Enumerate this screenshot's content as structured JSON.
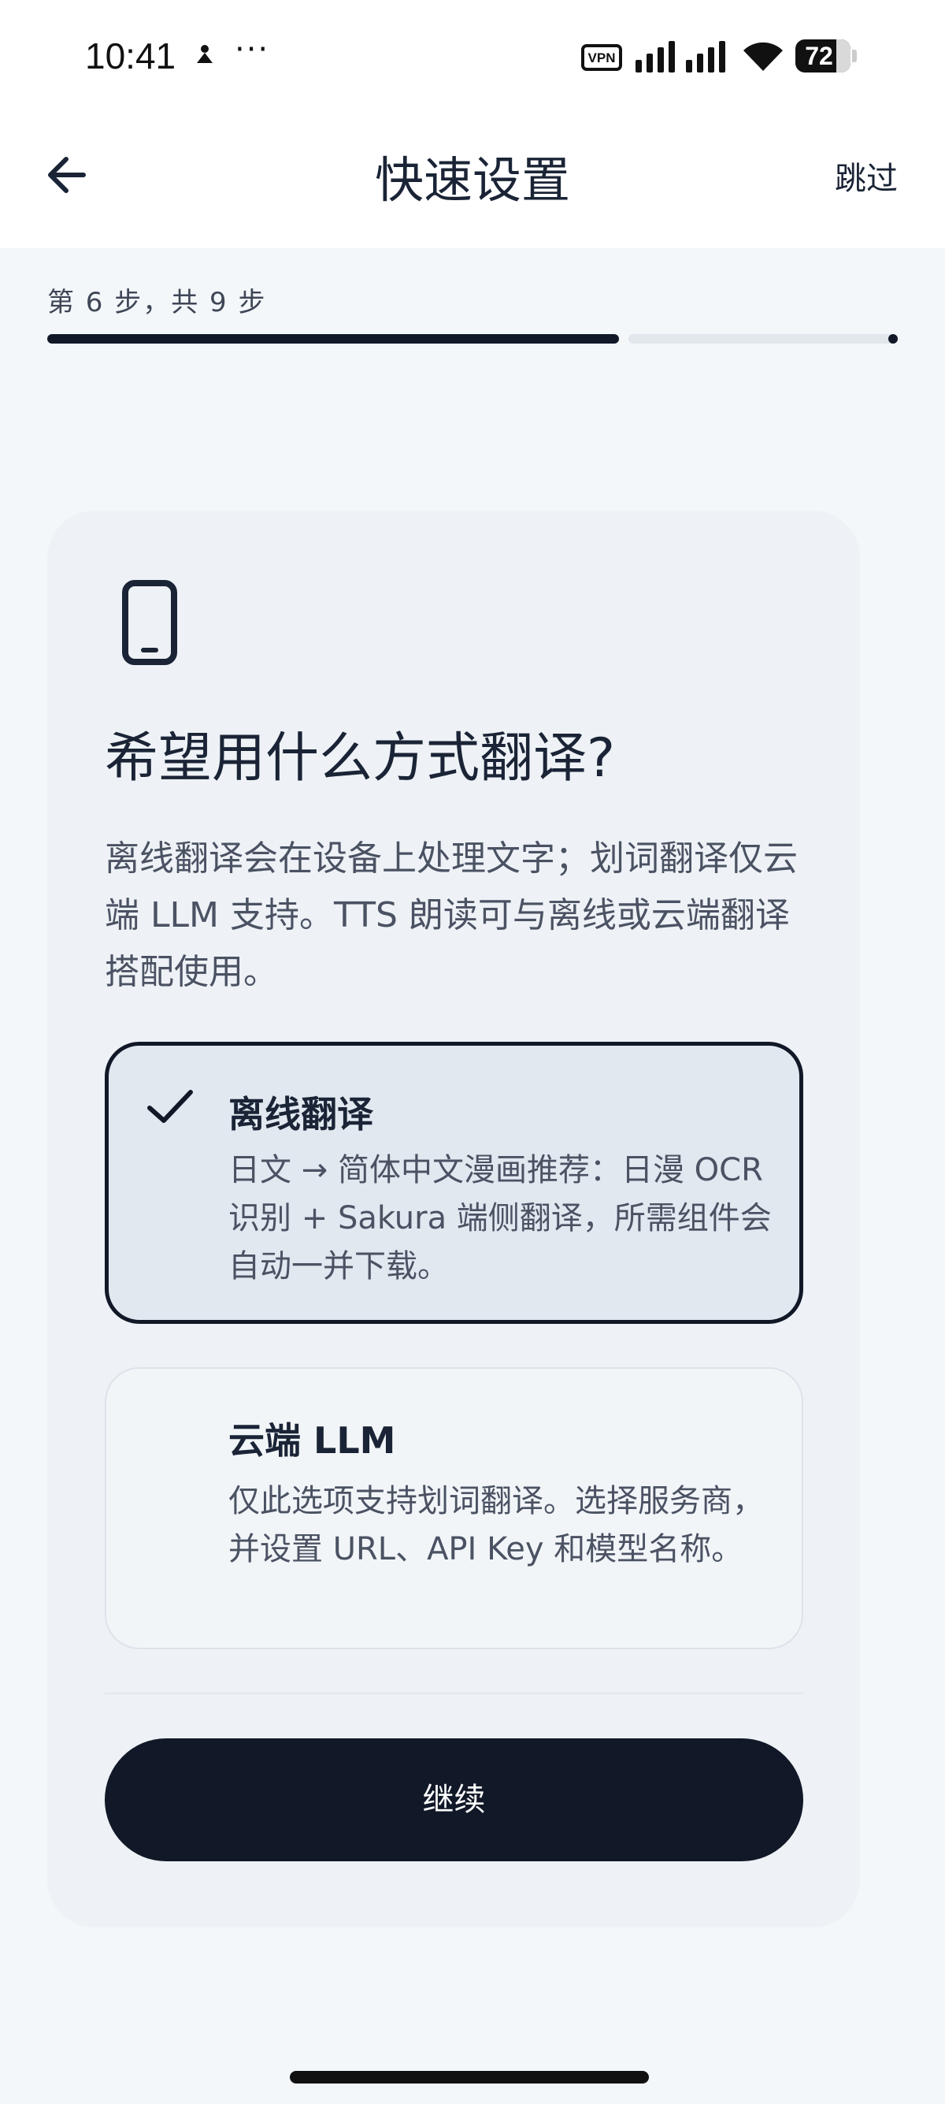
{
  "status_bar": {
    "time": "10:41",
    "dots": "···",
    "vpn_label": "VPN",
    "battery_level": "72"
  },
  "app_bar": {
    "title": "快速设置",
    "skip_label": "跳过",
    "back_icon": "arrow-left-icon"
  },
  "progress": {
    "step_text": "第 6 步，共 9 步",
    "current_step": 6,
    "total_steps": 9
  },
  "card": {
    "icon": "smartphone-icon",
    "question": "希望用什么方式翻译?",
    "description": "离线翻译会在设备上处理文字；划词翻译仅云端 LLM 支持。TTS 朗读可与离线或云端翻译搭配使用。",
    "options": [
      {
        "title": "离线翻译",
        "description": "日文 → 简体中文漫画推荐：日漫 OCR 识别 + Sakura 端侧翻译，所需组件会自动一并下载。",
        "selected": true
      },
      {
        "title": "云端 LLM",
        "description": "仅此选项支持划词翻译。选择服务商，并设置 URL、API Key 和模型名称。",
        "selected": false
      }
    ],
    "continue_label": "继续"
  },
  "colors": {
    "accent_dark": "#111827",
    "page_bg": "#f4f7fa",
    "card_bg": "#eef2f6",
    "selected_option_bg": "#e2e8f0"
  }
}
